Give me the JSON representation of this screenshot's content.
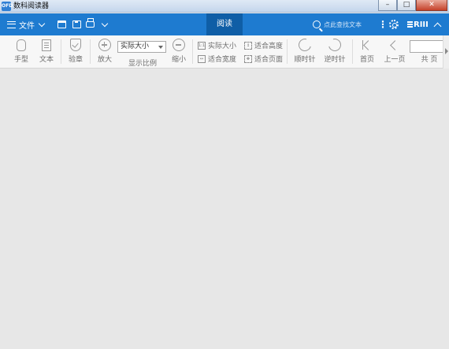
{
  "window": {
    "title": "数科阅读器",
    "app_icon_text": "OFD",
    "controls": {
      "minimize": "–",
      "maximize": "□",
      "close": "✕"
    }
  },
  "commandbar": {
    "file_menu": "文件",
    "active_tab": "阅读",
    "search_placeholder": "点此查找文本",
    "more": "⋮",
    "brand": "RIII"
  },
  "ribbon": {
    "hand": "手型",
    "text": "文本",
    "verify": "验章",
    "zoom_in": "放大",
    "zoom_select_value": "实际大小",
    "zoom_caption": "显示比例",
    "zoom_out": "缩小",
    "actual_size": "实际大小",
    "fit_height": "适合高度",
    "fit_width": "适合宽度",
    "fit_page": "适合页面",
    "rotate_cw": "顺时针",
    "rotate_ccw": "逆时针",
    "first_page": "首页",
    "prev_page": "上一页",
    "page_total": "共 页"
  },
  "colors": {
    "command_bar": "#1e7bd0",
    "active_tab": "#0f5ea6",
    "workspace": "#e7e7e7"
  }
}
